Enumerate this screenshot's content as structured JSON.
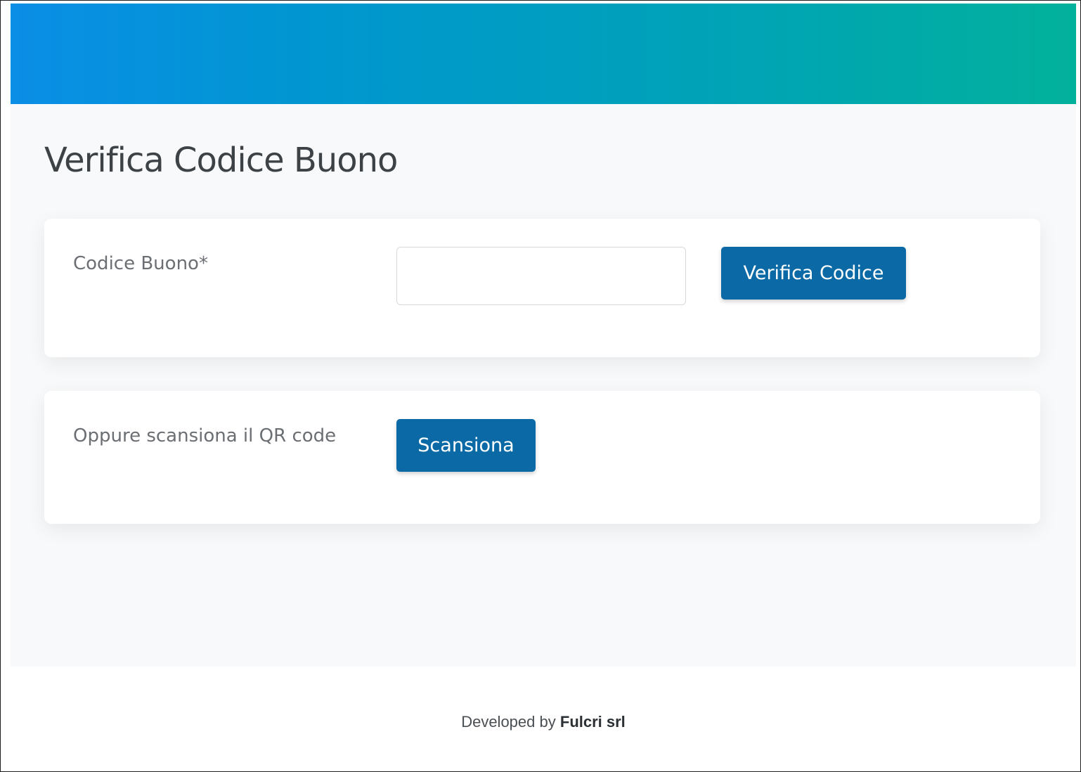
{
  "page": {
    "title": "Verifica Codice Buono"
  },
  "code_card": {
    "label": "Codice Buono*",
    "input_value": "",
    "input_placeholder": "",
    "button_label": "Verifica Codice"
  },
  "qr_card": {
    "label": "Oppure scansiona il QR code",
    "button_label": "Scansiona"
  },
  "footer": {
    "prefix": "Developed by",
    "company": "Fulcri srl"
  },
  "colors": {
    "header_gradient_start": "#0a8ee6",
    "header_gradient_end": "#02b19c",
    "button": "#0b6aa6",
    "main_background": "#f8f9fa"
  }
}
